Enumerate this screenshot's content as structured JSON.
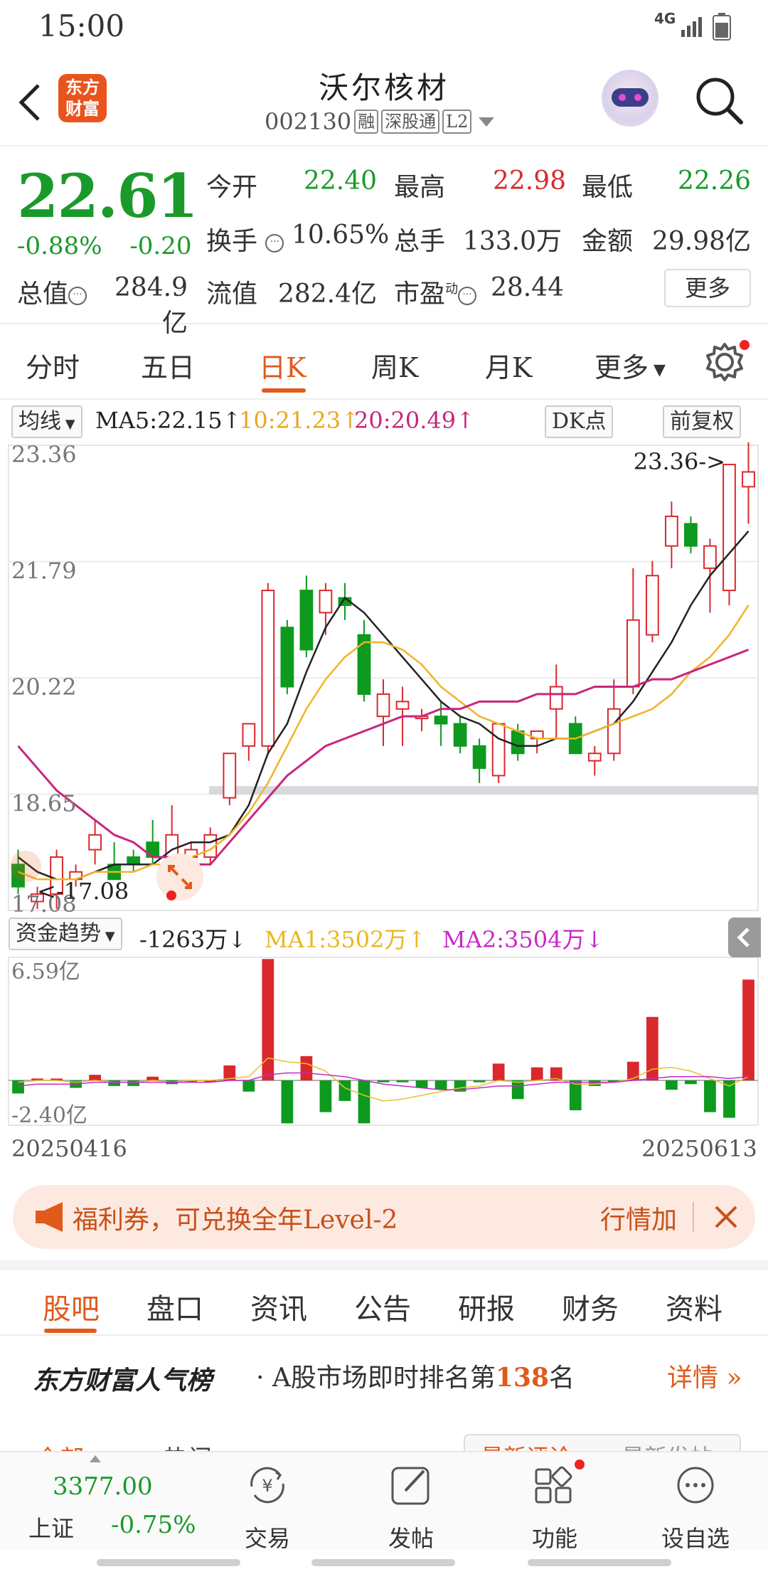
{
  "status": {
    "time": "15:00",
    "network": "4G"
  },
  "header": {
    "brand": "东方财富",
    "name": "沃尔核材",
    "code": "002130",
    "tags": [
      "融",
      "深股通",
      "L2"
    ]
  },
  "quote": {
    "price": "22.61",
    "change_pct": "-0.88%",
    "change": "-0.20",
    "open_label": "今开",
    "open": "22.40",
    "high_label": "最高",
    "high": "22.98",
    "low_label": "最低",
    "low": "22.26",
    "turnover_label": "换手",
    "turnover": "10.65%",
    "volume_label": "总手",
    "volume": "133.0万",
    "amount_label": "金额",
    "amount": "29.98亿",
    "mcap_label": "总值",
    "mcap": "284.9亿",
    "float_label": "流值",
    "float": "282.4亿",
    "pe_label": "市盈",
    "pe_sup": "动",
    "pe": "28.44",
    "more": "更多"
  },
  "tabs": [
    "分时",
    "五日",
    "日K",
    "周K",
    "月K",
    "更多"
  ],
  "active_tab": "日K",
  "ma_bar": {
    "type": "均线",
    "ma5": "MA5:22.15↑",
    "ma10": "10:21.23↑",
    "ma20": "20:20.49↑",
    "dk": "DK点",
    "adjust": "前复权"
  },
  "colors": {
    "up": "#d9292d",
    "down": "#0d9a1e",
    "ma5": "#222222",
    "ma10": "#f0b428",
    "ma20": "#c8267e",
    "accent": "#e05a1c"
  },
  "chart_data": [
    {
      "type": "candlestick",
      "title": "",
      "ylim": [
        17.08,
        23.36
      ],
      "yticks": [
        "23.36",
        "21.79",
        "20.22",
        "18.65",
        "17.08"
      ],
      "max_annotation": "23.36->",
      "min_annotation": "<-17.08",
      "series": [
        {
          "name": "K",
          "ohlc": [
            [
              17.7,
              17.9,
              17.3,
              17.4
            ],
            [
              17.2,
              17.4,
              17.1,
              17.3
            ],
            [
              17.3,
              17.9,
              17.1,
              17.8
            ],
            [
              17.5,
              17.7,
              17.4,
              17.6
            ],
            [
              17.9,
              18.3,
              17.7,
              18.1
            ],
            [
              17.7,
              18.0,
              17.6,
              17.5
            ],
            [
              17.8,
              17.9,
              17.6,
              17.7
            ],
            [
              18.0,
              18.3,
              17.7,
              17.8
            ],
            [
              17.8,
              18.5,
              17.6,
              18.1
            ],
            [
              17.8,
              18.0,
              17.7,
              17.9
            ],
            [
              17.8,
              18.2,
              17.7,
              18.1
            ],
            [
              18.6,
              18.8,
              18.5,
              19.2
            ],
            [
              19.3,
              19.5,
              19.1,
              19.6
            ],
            [
              19.3,
              21.5,
              19.2,
              21.4
            ],
            [
              20.9,
              21.0,
              20.0,
              20.1
            ],
            [
              21.4,
              21.6,
              20.5,
              20.6
            ],
            [
              21.1,
              21.5,
              20.8,
              21.4
            ],
            [
              21.3,
              21.5,
              21.0,
              21.2
            ],
            [
              20.8,
              21.0,
              19.9,
              20.0
            ],
            [
              19.7,
              20.2,
              19.3,
              20.0
            ],
            [
              19.8,
              20.1,
              19.3,
              19.9
            ],
            [
              19.7,
              19.8,
              19.5,
              19.7
            ],
            [
              19.7,
              19.9,
              19.3,
              19.6
            ],
            [
              19.6,
              19.7,
              19.2,
              19.3
            ],
            [
              19.3,
              19.4,
              18.8,
              19.0
            ],
            [
              18.9,
              19.6,
              18.8,
              19.6
            ],
            [
              19.5,
              19.6,
              19.1,
              19.2
            ],
            [
              19.4,
              19.5,
              19.2,
              19.5
            ],
            [
              19.8,
              20.4,
              19.4,
              20.1
            ],
            [
              19.6,
              19.7,
              19.2,
              19.2
            ],
            [
              19.1,
              19.3,
              18.9,
              19.2
            ],
            [
              19.2,
              20.2,
              19.1,
              19.8
            ],
            [
              20.1,
              21.7,
              20.0,
              21.0
            ],
            [
              20.8,
              21.8,
              20.7,
              21.6
            ],
            [
              22.0,
              22.6,
              21.7,
              22.4
            ],
            [
              22.3,
              22.4,
              21.9,
              22.0
            ],
            [
              21.7,
              22.1,
              21.1,
              22.0
            ],
            [
              21.4,
              23.0,
              21.2,
              23.1
            ],
            [
              22.8,
              23.4,
              22.3,
              23.0
            ]
          ]
        },
        {
          "name": "MA5",
          "values": [
            17.8,
            17.6,
            17.5,
            17.5,
            17.6,
            17.7,
            17.7,
            17.7,
            17.9,
            18.0,
            18.0,
            18.1,
            18.5,
            19.2,
            19.6,
            20.3,
            20.9,
            21.3,
            21.1,
            20.8,
            20.5,
            20.2,
            19.9,
            19.7,
            19.6,
            19.4,
            19.3,
            19.3,
            19.4,
            19.4,
            19.5,
            19.6,
            19.9,
            20.3,
            20.7,
            21.2,
            21.6,
            21.9,
            22.2
          ]
        },
        {
          "name": "MA10",
          "values": [
            17.6,
            17.5,
            17.5,
            17.5,
            17.6,
            17.6,
            17.6,
            17.7,
            17.7,
            17.8,
            17.9,
            18.1,
            18.4,
            18.8,
            19.3,
            19.8,
            20.2,
            20.5,
            20.7,
            20.7,
            20.6,
            20.4,
            20.1,
            19.9,
            19.7,
            19.6,
            19.5,
            19.4,
            19.4,
            19.4,
            19.5,
            19.6,
            19.7,
            19.8,
            20.0,
            20.3,
            20.5,
            20.8,
            21.2
          ]
        },
        {
          "name": "MA20",
          "values": [
            19.3,
            19.0,
            18.7,
            18.5,
            18.3,
            18.1,
            18.0,
            17.8,
            17.8,
            17.7,
            17.7,
            18.0,
            18.3,
            18.6,
            18.9,
            19.1,
            19.3,
            19.4,
            19.5,
            19.6,
            19.7,
            19.7,
            19.8,
            19.8,
            19.9,
            19.9,
            19.9,
            20.0,
            20.0,
            20.0,
            20.1,
            20.1,
            20.1,
            20.2,
            20.2,
            20.3,
            20.4,
            20.5,
            20.6
          ]
        }
      ]
    },
    {
      "type": "bar",
      "title": "资金趋势",
      "ylabel": "",
      "ylim": [
        -2.4,
        6.59
      ],
      "yticks": [
        "6.59亿",
        "-2.40亿"
      ],
      "x_start": "20250416",
      "x_end": "20250613",
      "series": [
        {
          "name": "资金",
          "values": [
            -0.7,
            0.1,
            0.1,
            -0.4,
            0.3,
            -0.3,
            -0.3,
            0.2,
            -0.2,
            -0.1,
            0.0,
            0.8,
            -0.6,
            6.5,
            -2.3,
            1.3,
            -1.7,
            -1.1,
            -2.3,
            -0.1,
            -0.1,
            -0.4,
            -0.5,
            -0.6,
            -0.1,
            0.9,
            -1.0,
            0.7,
            0.7,
            -1.6,
            -0.3,
            -0.1,
            1.0,
            3.4,
            -0.5,
            -0.2,
            -1.7,
            -2.0,
            5.4
          ]
        },
        {
          "name": "MA1",
          "values": [
            -0.1,
            0.0,
            0.0,
            -0.1,
            0.0,
            -0.1,
            -0.1,
            0.0,
            -0.1,
            0.0,
            0.0,
            0.1,
            0.2,
            1.2,
            1.0,
            0.9,
            0.5,
            -0.4,
            -0.8,
            -1.1,
            -1.0,
            -0.8,
            -0.6,
            -0.4,
            -0.3,
            0.0,
            -0.1,
            0.0,
            0.1,
            -0.2,
            -0.2,
            -0.1,
            0.1,
            0.6,
            0.7,
            0.5,
            0.1,
            -0.3,
            0.2
          ]
        },
        {
          "name": "MA2",
          "values": [
            -0.3,
            -0.2,
            -0.2,
            -0.2,
            -0.1,
            -0.1,
            -0.1,
            -0.1,
            -0.1,
            -0.1,
            -0.1,
            0.0,
            0.0,
            0.3,
            0.4,
            0.4,
            0.3,
            0.2,
            0.0,
            -0.2,
            -0.3,
            -0.4,
            -0.5,
            -0.5,
            -0.4,
            -0.3,
            -0.3,
            -0.2,
            -0.1,
            -0.1,
            -0.1,
            -0.1,
            0.0,
            0.1,
            0.2,
            0.2,
            0.2,
            0.1,
            0.2
          ]
        }
      ]
    }
  ],
  "fund_bar": {
    "type": "资金趋势",
    "value": "-1263万↓",
    "ma1": "MA1:3502万↑",
    "ma2": "MA2:3504万↓"
  },
  "banner": {
    "text": "福利券，可兑换全年Level-2",
    "right": "行情加"
  },
  "sub_tabs": [
    "股吧",
    "盘口",
    "资讯",
    "公告",
    "研报",
    "财务",
    "资料"
  ],
  "rank": {
    "brand": "东方财富人气榜",
    "text_pre": "· A股市场即时排名第",
    "rank": "138",
    "text_post": "名",
    "detail": "详情"
  },
  "peek": {
    "left1": "全部",
    "left2": "热门",
    "right1": "最新评论",
    "right2": "最新发帖"
  },
  "bottom_nav": {
    "index_value": "3377.00",
    "index_name": "上证",
    "index_change": "-0.75%",
    "items": [
      {
        "label": "交易",
        "icon": "yen-exchange-icon"
      },
      {
        "label": "发帖",
        "icon": "edit-post-icon"
      },
      {
        "label": "功能",
        "icon": "grid-apps-icon"
      },
      {
        "label": "设自选",
        "icon": "more-dots-icon"
      }
    ]
  }
}
